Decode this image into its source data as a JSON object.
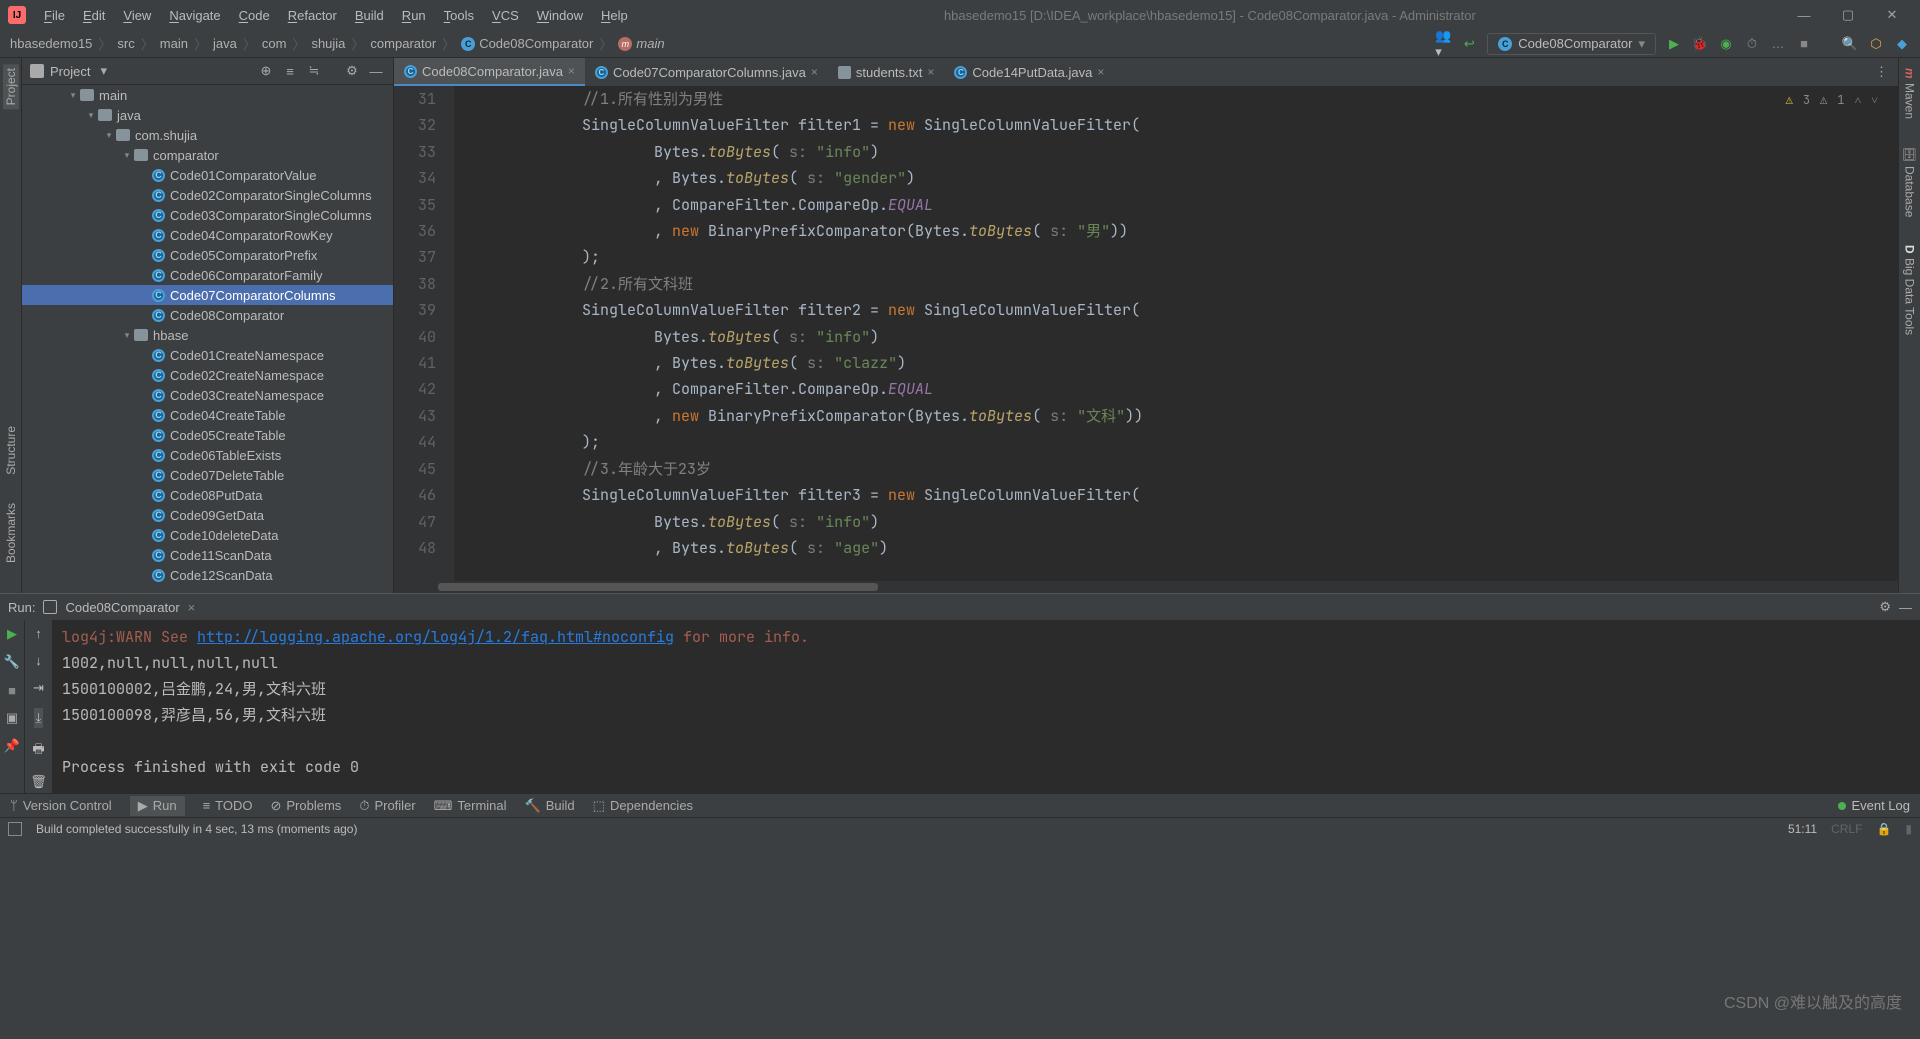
{
  "title": "hbasedemo15 [D:\\IDEA_workplace\\hbasedemo15] - Code08Comparator.java - Administrator",
  "menu": [
    "File",
    "Edit",
    "View",
    "Navigate",
    "Code",
    "Refactor",
    "Build",
    "Run",
    "Tools",
    "VCS",
    "Window",
    "Help"
  ],
  "breadcrumbs": [
    "hbasedemo15",
    "src",
    "main",
    "java",
    "com",
    "shujia",
    "comparator"
  ],
  "breadcrumb_class": "Code08Comparator",
  "breadcrumb_method": "main",
  "runconfig": "Code08Comparator",
  "project_label": "Project",
  "left_tools": [
    "Project",
    "Structure",
    "Bookmarks"
  ],
  "right_tools": [
    "Maven",
    "Database",
    "Big Data Tools"
  ],
  "tree": {
    "main": "main",
    "java": "java",
    "comshujia": "com.shujia",
    "comparator": "comparator",
    "comparator_files": [
      "Code01ComparatorValue",
      "Code02ComparatorSingleColumns",
      "Code03ComparatorSingleColumns",
      "Code04ComparatorRowKey",
      "Code05ComparatorPrefix",
      "Code06ComparatorFamily",
      "Code07ComparatorColumns",
      "Code08Comparator"
    ],
    "hbase": "hbase",
    "hbase_files": [
      "Code01CreateNamespace",
      "Code02CreateNamespace",
      "Code03CreateNamespace",
      "Code04CreateTable",
      "Code05CreateTable",
      "Code06TableExists",
      "Code07DeleteTable",
      "Code08PutData",
      "Code09GetData",
      "Code10deleteData",
      "Code11ScanData",
      "Code12ScanData"
    ],
    "selected": "Code07ComparatorColumns"
  },
  "tabs": [
    {
      "label": "Code08Comparator.java",
      "icon": "class",
      "active": true
    },
    {
      "label": "Code07ComparatorColumns.java",
      "icon": "class"
    },
    {
      "label": "students.txt",
      "icon": "txt"
    },
    {
      "label": "Code14PutData.java",
      "icon": "class"
    }
  ],
  "inspection": {
    "error_count": "3",
    "warn_count": "1"
  },
  "line_start": 31,
  "code_lines": [
    {
      "t": "cm",
      "x": "            //1.所有性别为男性"
    },
    {
      "t": "p",
      "x": "            SingleColumnValueFilter filter1 = ",
      "kw": "new",
      "x2": " SingleColumnValueFilter("
    },
    {
      "t": "b",
      "pre": "                    Bytes.",
      "m": "toBytes",
      "post": "( ",
      "h": "s:",
      "s": " \"info\"",
      "tail": ")"
    },
    {
      "t": "b",
      "pre": "                    , Bytes.",
      "m": "toBytes",
      "post": "( ",
      "h": "s:",
      "s": " \"gender\"",
      "tail": ")"
    },
    {
      "t": "c",
      "pre": "                    , CompareFilter.CompareOp.",
      "cn": "EQUAL"
    },
    {
      "t": "n",
      "pre": "                    , ",
      "kw": "new",
      "mid": " BinaryPrefixComparator(Bytes.",
      "m": "toBytes",
      "post": "( ",
      "h": "s:",
      "s": " \"男\"",
      "tail": "))"
    },
    {
      "t": "p",
      "x": "            );"
    },
    {
      "t": "cm",
      "x": "            //2.所有文科班"
    },
    {
      "t": "p",
      "x": "            SingleColumnValueFilter filter2 = ",
      "kw": "new",
      "x2": " SingleColumnValueFilter("
    },
    {
      "t": "b",
      "pre": "                    Bytes.",
      "m": "toBytes",
      "post": "( ",
      "h": "s:",
      "s": " \"info\"",
      "tail": ")"
    },
    {
      "t": "b",
      "pre": "                    , Bytes.",
      "m": "toBytes",
      "post": "( ",
      "h": "s:",
      "s": " \"clazz\"",
      "tail": ")"
    },
    {
      "t": "c",
      "pre": "                    , CompareFilter.CompareOp.",
      "cn": "EQUAL"
    },
    {
      "t": "n",
      "pre": "                    , ",
      "kw": "new",
      "mid": " BinaryPrefixComparator(Bytes.",
      "m": "toBytes",
      "post": "( ",
      "h": "s:",
      "s": " \"文科\"",
      "tail": "))"
    },
    {
      "t": "p",
      "x": "            );"
    },
    {
      "t": "cm",
      "x": "            //3.年龄大于23岁"
    },
    {
      "t": "p",
      "x": "            SingleColumnValueFilter filter3 = ",
      "kw": "new",
      "x2": " SingleColumnValueFilter("
    },
    {
      "t": "b",
      "pre": "                    Bytes.",
      "m": "toBytes",
      "post": "( ",
      "h": "s:",
      "s": " \"info\"",
      "tail": ")"
    },
    {
      "t": "b",
      "pre": "                    , Bytes.",
      "m": "toBytes",
      "post": "( ",
      "h": "s:",
      "s": " \"age\"",
      "tail": ")"
    }
  ],
  "run_tab": "Code08Comparator",
  "run_label": "Run:",
  "console": {
    "warn_prefix": "log4j:WARN See ",
    "warn_link": "http://logging.apache.org/log4j/1.2/faq.html#noconfig",
    "warn_suffix": " for more info.",
    "lines": [
      "1002,null,null,null,null",
      "1500100002,吕金鹏,24,男,文科六班",
      "1500100098,羿彦昌,56,男,文科六班",
      "",
      "Process finished with exit code 0"
    ]
  },
  "bottom_tools": [
    {
      "icon": "branch",
      "label": "Version Control"
    },
    {
      "icon": "play",
      "label": "Run",
      "active": true
    },
    {
      "icon": "todo",
      "label": "TODO"
    },
    {
      "icon": "prob",
      "label": "Problems"
    },
    {
      "icon": "prof",
      "label": "Profiler"
    },
    {
      "icon": "term",
      "label": "Terminal"
    },
    {
      "icon": "build",
      "label": "Build"
    },
    {
      "icon": "dep",
      "label": "Dependencies"
    }
  ],
  "event_log": "Event Log",
  "status": {
    "msg": "Build completed successfully in 4 sec, 13 ms (moments ago)",
    "pos": "51:11",
    "watermark": "CSDN @难以触及的高度"
  }
}
